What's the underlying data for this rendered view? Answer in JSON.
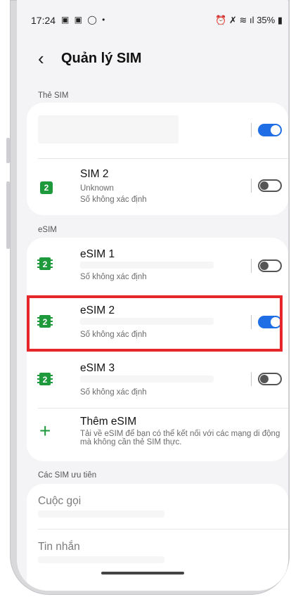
{
  "status_bar": {
    "time": "17:24",
    "left_icons": "▣ ▣ ◯ •",
    "right_icons": "⏰ ✗ ≋ ıl",
    "battery": "35%"
  },
  "header": {
    "back_icon": "‹",
    "title": "Quản lý SIM"
  },
  "sections": {
    "sim_cards": "Thẻ SIM",
    "esim": "eSIM",
    "preferred": "Các SIM ưu tiên"
  },
  "sim_cards": [
    {
      "name": "",
      "enabled": true
    },
    {
      "icon": "2",
      "name": "SIM 2",
      "line1": "Unknown",
      "line2": "Số không xác định",
      "enabled": false
    }
  ],
  "esims": [
    {
      "icon": "2",
      "name": "eSIM 1",
      "line2": "Số không xác định",
      "enabled": false
    },
    {
      "icon": "2",
      "name": "eSIM 2",
      "line2": "Số không xác định",
      "enabled": true,
      "highlighted": true
    },
    {
      "icon": "2",
      "name": "eSIM 3",
      "line2": "Số không xác định",
      "enabled": false
    }
  ],
  "add_esim": {
    "icon": "+",
    "title": "Thêm eSIM",
    "description": "Tải về eSIM để bạn có thể kết nối với các mạng di động mà không cần thẻ SIM thực."
  },
  "preferred_sims": [
    {
      "label": "Cuộc gọi"
    },
    {
      "label": "Tin nhắn"
    }
  ],
  "colors": {
    "accent": "#1f6ee6",
    "sim_green": "#1e9a3c",
    "highlight": "#e5262a"
  }
}
